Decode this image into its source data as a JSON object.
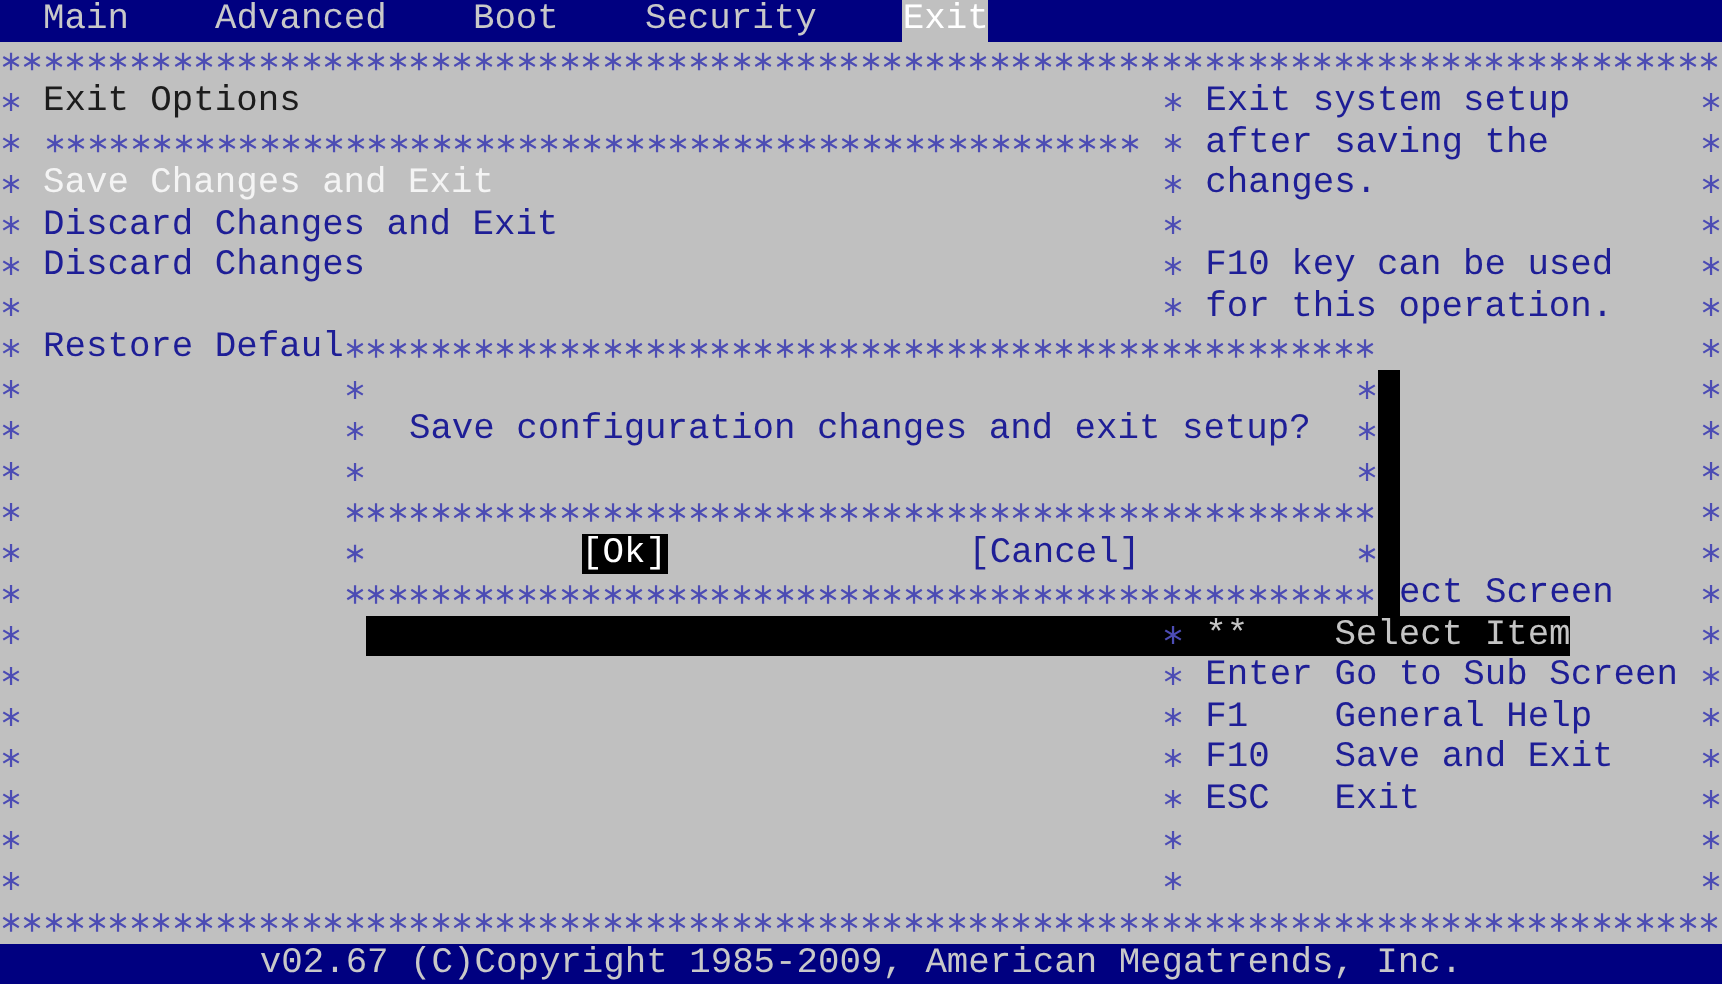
{
  "menu_bar": {
    "tabs": [
      {
        "label": "Main",
        "selected": false
      },
      {
        "label": "Advanced",
        "selected": false
      },
      {
        "label": "Boot",
        "selected": false
      },
      {
        "label": "Security",
        "selected": false
      },
      {
        "label": "Exit",
        "selected": true
      }
    ]
  },
  "options_panel": {
    "title": "Exit Options",
    "groups": [
      [
        {
          "label": "Save Changes and Exit",
          "selected": true
        },
        {
          "label": "Discard Changes and Exit",
          "selected": false
        },
        {
          "label": "Discard Changes",
          "selected": false
        }
      ],
      [
        {
          "label": "Restore Defaul",
          "selected": false
        }
      ]
    ]
  },
  "help_panel": {
    "description": "Exit system setup after saving the changes.",
    "note": "F10 key can be used for this operation.",
    "keys": [
      {
        "action": "ect Screen",
        "shadowed": false
      },
      {
        "key": "**",
        "action": "Select Item",
        "shadowed": true
      },
      {
        "key": "Enter",
        "action": "Go to Sub Screen",
        "shadowed": false
      },
      {
        "key": "F1",
        "action": "General Help",
        "shadowed": false
      },
      {
        "key": "F10",
        "action": "Save and Exit",
        "shadowed": false
      },
      {
        "key": "ESC",
        "action": "Exit",
        "shadowed": false
      }
    ]
  },
  "dialog": {
    "message": "Save configuration changes and exit setup?",
    "buttons": [
      {
        "label": "[Ok]",
        "selected": true
      },
      {
        "label": "[Cancel]",
        "selected": false
      }
    ]
  },
  "status_bar": {
    "text": "v02.67 (C)Copyright 1985-2009, American Megatrends, Inc."
  }
}
